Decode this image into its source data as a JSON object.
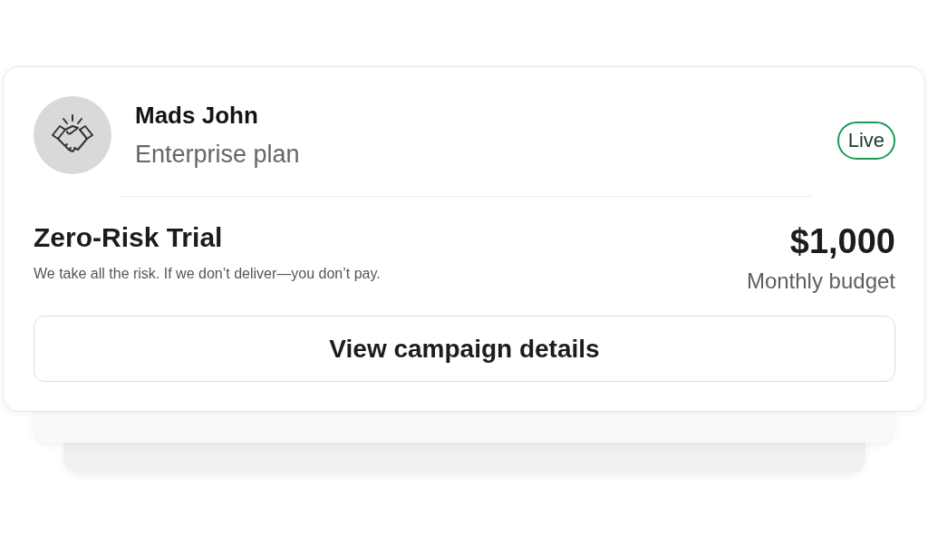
{
  "account": {
    "name": "Mads John",
    "plan": "Enterprise plan",
    "status": {
      "label": "Live",
      "color": "#1a9a5a"
    }
  },
  "offer": {
    "title": "Zero-Risk Trial",
    "description": "We take all the risk. If we don’t deliver—you don’t pay.",
    "amount": "$1,000",
    "amount_label": "Monthly budget"
  },
  "button": "View campaign details"
}
